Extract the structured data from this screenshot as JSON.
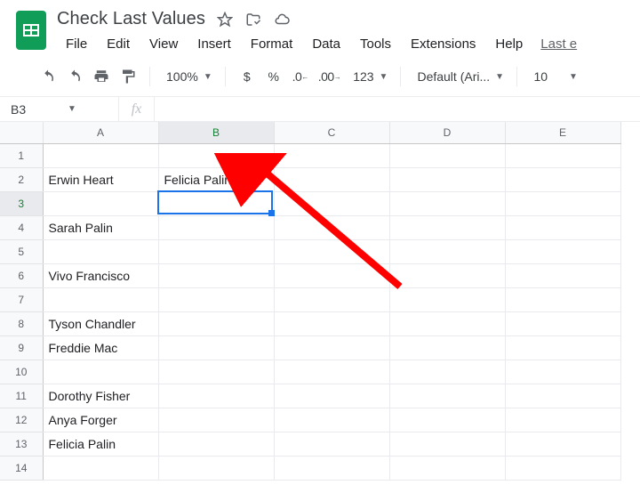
{
  "doc": {
    "title": "Check Last Values"
  },
  "menubar": {
    "file": "File",
    "edit": "Edit",
    "view": "View",
    "insert": "Insert",
    "format": "Format",
    "data": "Data",
    "tools": "Tools",
    "extensions": "Extensions",
    "help": "Help",
    "last_edit": "Last e"
  },
  "toolbar": {
    "zoom": "100%",
    "num_format_123": "123",
    "font": "Default (Ari...",
    "font_size": "10"
  },
  "namebox": "B3",
  "fx_label": "fx",
  "formula": "",
  "columns": [
    "A",
    "B",
    "C",
    "D",
    "E"
  ],
  "active_col": "B",
  "active_row": 3,
  "rows": [
    {
      "n": 1,
      "A": "",
      "B": ""
    },
    {
      "n": 2,
      "A": "Erwin Heart",
      "B": "Felicia Palin"
    },
    {
      "n": 3,
      "A": "",
      "B": ""
    },
    {
      "n": 4,
      "A": "Sarah Palin",
      "B": ""
    },
    {
      "n": 5,
      "A": "",
      "B": ""
    },
    {
      "n": 6,
      "A": "Vivo Francisco",
      "B": ""
    },
    {
      "n": 7,
      "A": "",
      "B": ""
    },
    {
      "n": 8,
      "A": "Tyson Chandler",
      "B": ""
    },
    {
      "n": 9,
      "A": "Freddie Mac",
      "B": ""
    },
    {
      "n": 10,
      "A": "",
      "B": ""
    },
    {
      "n": 11,
      "A": "Dorothy Fisher",
      "B": ""
    },
    {
      "n": 12,
      "A": "Anya Forger",
      "B": ""
    },
    {
      "n": 13,
      "A": "Felicia Palin",
      "B": ""
    },
    {
      "n": 14,
      "A": "",
      "B": ""
    }
  ]
}
